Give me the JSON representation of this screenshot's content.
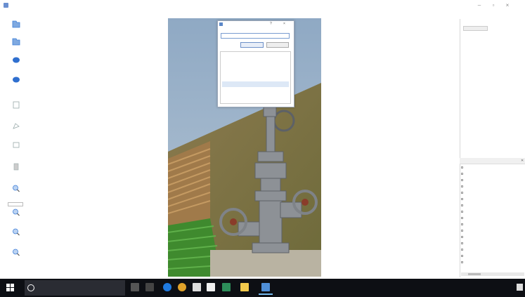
{
  "window": {
    "title": "",
    "menu": [
      "",
      "",
      "",
      ""
    ]
  },
  "toolbar": {
    "tools": [
      {
        "label": "",
        "icon": "open-folder-icon",
        "color": "#3b7dd8"
      },
      {
        "label": "",
        "icon": "open-dir-icon",
        "color": "#3b7dd8"
      },
      {
        "label": "",
        "icon": "arrow-next-icon",
        "color": "#3b7dd8"
      },
      {
        "label": "",
        "icon": "arrow-prev-icon",
        "color": "#3b7dd8"
      },
      {
        "label": "",
        "icon": "save-icon",
        "color": "#9aa"
      },
      {
        "label": "",
        "icon": "create-polygon-icon",
        "color": "#9aa"
      },
      {
        "label": "",
        "icon": "create-rect-icon",
        "color": "#9aa"
      },
      {
        "label": "",
        "icon": "delete-icon",
        "color": "#9aa"
      },
      {
        "label": "",
        "icon": "zoom-in-icon",
        "color": "#3b7dd8"
      },
      {
        "label": "",
        "icon": "zoom-out-icon",
        "color": "#3b7dd8"
      },
      {
        "label": "",
        "icon": "fit-window-icon",
        "color": "#3b7dd8"
      },
      {
        "label": "",
        "icon": "fit-width-icon",
        "color": "#3b7dd8"
      }
    ],
    "zoom_value": ""
  },
  "dialog": {
    "title": "",
    "input_value": "",
    "ok_label": "",
    "cancel_label": "",
    "items": [
      "",
      "",
      "",
      "",
      "",
      ""
    ],
    "selected_index": 5
  },
  "panels": {
    "top_title": "",
    "top_field": "",
    "bottom_title": "",
    "bottom_close": "✕",
    "files": [
      "",
      "",
      "",
      "",
      "",
      "",
      "",
      "",
      "",
      "",
      "",
      "",
      "",
      "",
      "",
      ""
    ]
  },
  "taskbar": {
    "search_placeholder": "",
    "tray": "",
    "time": "",
    "date": ""
  },
  "colors": {
    "accent": "#3b7dd8",
    "taskbar": "#0d0f14",
    "dialog_border": "#9aa6b8"
  }
}
